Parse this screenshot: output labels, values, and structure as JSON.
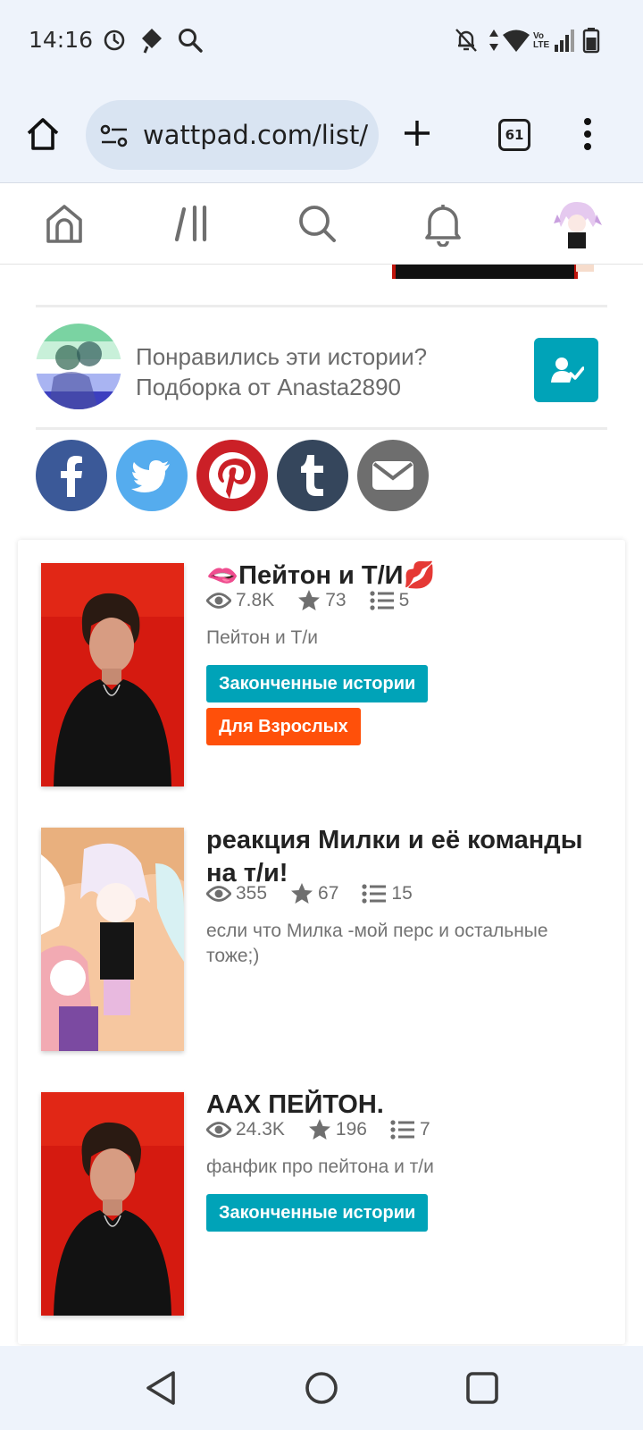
{
  "status_bar": {
    "time": "14:16",
    "icons": [
      "alarm-icon",
      "location-diamond-icon",
      "search-icon",
      "mute-notifications-icon",
      "data-arrows-icon",
      "wifi-icon",
      "volte-icon",
      "signal-icon",
      "battery-icon"
    ],
    "volte_label": "Vo LTE"
  },
  "browser": {
    "url": "wattpad.com/list/",
    "tab_count": "61",
    "icons": [
      "home-icon",
      "site-settings-icon",
      "new-tab-icon",
      "tabs-icon",
      "more-menu-icon"
    ]
  },
  "wattpad_nav": {
    "items": [
      "home-icon",
      "library-icon",
      "search-icon",
      "notifications-icon",
      "profile-avatar"
    ]
  },
  "curator": {
    "line1": "Понравились эти истории?",
    "line2": "Подборка от Anasta2890"
  },
  "share": [
    "facebook",
    "twitter",
    "pinterest",
    "tumblr",
    "email"
  ],
  "colors": {
    "accent": "#00a3b8",
    "mature": "#ff500a",
    "facebook": "#3b5998",
    "twitter": "#55acee",
    "pinterest": "#cb2027",
    "tumblr": "#35465c",
    "email": "#6e6e6e"
  },
  "stories": [
    {
      "title": "🫦Пейтон и Т/И💋",
      "reads": "7.8K",
      "votes": "73",
      "parts": "5",
      "description": "Пейтон и Т/и",
      "tags": [
        "Законченные истории",
        "Для Взрослых"
      ]
    },
    {
      "title": "реакция Милки и её команды на т/и!",
      "reads": "355",
      "votes": "67",
      "parts": "15",
      "description": "если что Милка -мой перс и остальные тоже;)",
      "tags": []
    },
    {
      "title": "ААХ ПЕЙТОН.",
      "reads": "24.3K",
      "votes": "196",
      "parts": "7",
      "description": "фанфик про пейтона и т/и",
      "tags": [
        "Законченные истории"
      ]
    }
  ]
}
